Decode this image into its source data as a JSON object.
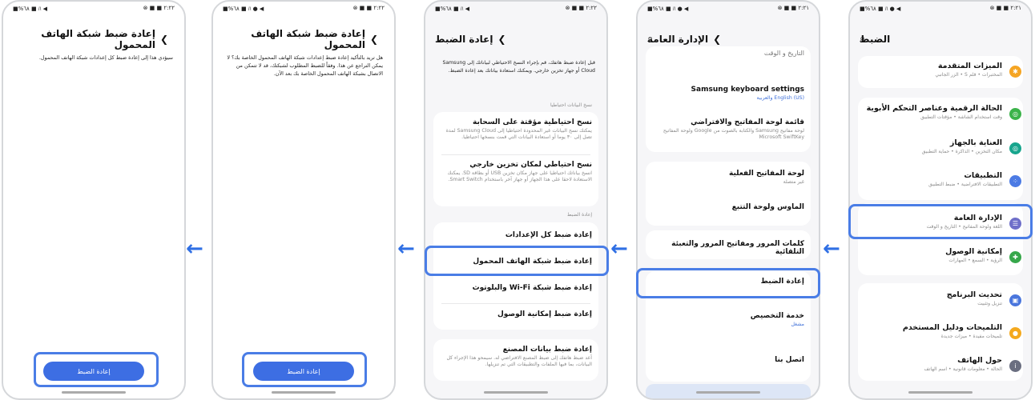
{
  "status": {
    "p1": {
      "left": "■%٦٨ ■ ﾊ ● ◀",
      "right": "⊗ ■ ■ ٢:٢١"
    },
    "p2": {
      "left": "■%٦٨ ■ ﾊ ● ◀",
      "right": "⊗ ■ ■ ٢:٢١"
    },
    "p3": {
      "left": "■%٦٨ ■ ﾊ ◀",
      "right": "⊗ ■ ■ ٢:٢٢"
    },
    "p4": {
      "left": "■%٦٨ ■ ﾊ ● ◀",
      "right": "⊗ ■ ■ ٢:٢٢"
    },
    "p5": {
      "left": "■%٦٨ ■ ﾊ ◀",
      "right": "⊗ ■ ■ ٢:٢٢"
    }
  },
  "screen1": {
    "title": "الضبط",
    "items": [
      {
        "title": "الميزات المتقدمة",
        "sub": "المختبرات • قلم S • الزر الجانبي",
        "color": "#f5a524",
        "icon": "gear-advanced-icon"
      },
      {
        "title": "الحالة الرقمية وعناصر التحكم الأبوية",
        "sub": "وقت استخدام الشاشة • مؤقتات التطبيق",
        "color": "#3bb34a",
        "icon": "digital-wellbeing-icon"
      },
      {
        "title": "العناية بالجهاز",
        "sub": "مكان التخزين • الذاكرة • حماية التطبيق",
        "color": "#17a58d",
        "icon": "device-care-icon"
      },
      {
        "title": "التطبيقات",
        "sub": "التطبيقات الافتراضية • ضبط التطبيق",
        "color": "#4c7be4",
        "icon": "apps-grid-icon"
      },
      {
        "title": "الإدارة العامة",
        "sub": "اللغة ولوحة المفاتيح • التاريخ و الوقت",
        "color": "#6f6fc9",
        "icon": "general-management-icon"
      },
      {
        "title": "إمكانية الوصول",
        "sub": "الرؤية • السمع • المهارات",
        "color": "#37a74b",
        "icon": "accessibility-icon"
      },
      {
        "title": "تحديث البرنامج",
        "sub": "تنزيل وتثبيت",
        "color": "#4a76dd",
        "icon": "software-update-icon"
      },
      {
        "title": "التلميحات ودليل المستخدم",
        "sub": "تلميحات مفيدة • ميزات جديدة",
        "color": "#f4a91e",
        "icon": "tips-bulb-icon"
      },
      {
        "title": "حول الهاتف",
        "sub": "الحالة • معلومات قانونية • اسم الهاتف",
        "color": "#6a6e80",
        "icon": "info-icon"
      }
    ]
  },
  "screen2": {
    "title": "الإدارة العامة",
    "cut_item": "التاريخ و الوقت",
    "items": [
      {
        "title": "Samsung keyboard settings",
        "sub": "English (US) والعربية",
        "blue": true
      },
      {
        "title": "قائمة لوحة المفاتيح والافتراضي",
        "sub": "لوحة مفاتيح Samsung والكتابة بالصوت من Google ولوحة المفاتيح Microsoft SwiftKey"
      },
      {
        "title": "لوحة المفاتيح الفعلية",
        "sub": "غير متصلة"
      },
      {
        "title": "الماوس ولوحة التتبع",
        "sub": ""
      },
      {
        "title": "كلمات المرور ومفاتيح المرور والتعبئة التلقائية",
        "sub": ""
      },
      {
        "title": "إعادة الضبط",
        "sub": ""
      },
      {
        "title": "خدمة التخصيص",
        "sub": "مشغل",
        "blue": true
      },
      {
        "title": "اتصل بنا",
        "sub": ""
      }
    ]
  },
  "screen3": {
    "title": "إعادة الضبط",
    "intro": "قبل إعادة ضبط هاتفك، قم بإجراء النسخ الاحتياطي لبياناتك إلى Samsung Cloud أو جهاز تخزين خارجي. ويمكنك استعادة بياناتك بعد إعادة الضبط.",
    "backup_header": "نسخ البيانات احتياطيا",
    "cloud": {
      "title": "نسخ احتياطية مؤقتة على السحابة",
      "sub": "يمكنك نسخ البيانات غير المحدودة احتياطيا إلى Samsung Cloud لمدة تصل إلى ٣٠ يوما أو استعادة البيانات التي قمت بنسخها احتياطيا."
    },
    "external": {
      "title": "نسخ احتياطي لمكان تخزين خارجي",
      "sub": "انسخ بياناتك احتياطيا على جهاز مكان تخزين USB أو بطاقة SD. يمكنك الاستعادة لاحقا على هذا الجهاز أو جهاز آخر باستخدام Smart Switch."
    },
    "reset_header": "إعادة الضبط",
    "all": "إعادة ضبط كل الإعدادات",
    "network": "إعادة ضبط شبكة الهاتف المحمول",
    "wifi": "إعادة ضبط شبكة Wi-Fi والبلوتوث",
    "access": "إعادة ضبط إمكانية الوصول",
    "factory": {
      "title": "إعادة ضبط بيانات المصنع",
      "sub": "أعد ضبط هاتفك إلى ضبط المصنع الافتراضي له. سيمحو هذا الإجراء كل البيانات، بما فيها الملفات والتطبيقات التي تم تنزيلها."
    }
  },
  "screen4": {
    "title": "إعادة ضبط شبكة الهاتف المحمول",
    "body": "هل تريد بالتأكيد إعادة ضبط إعدادات شبكة الهاتف المحمول الخاصة بك؟ لا يمكن التراجع عن هذا. وفقاً للضبط المطلوب لشبكتك، قد لا تتمكن من الاتصال بشبكة الهاتف المحمول الخاصة بك بعد الآن.",
    "button": "إعادة الضبط"
  },
  "screen5": {
    "title": "إعادة ضبط شبكة الهاتف المحمول",
    "body": "سيؤدي هذا إلى إعادة ضبط كل إعدادات شبكة الهاتف المحمول.",
    "button": "إعادة الضبط"
  },
  "arrows": {
    "a1": "←",
    "a2": "←",
    "a3": "←",
    "a4": "←"
  },
  "colors": {
    "accent": "#3d6ee3",
    "highlight": "#4a7de6"
  }
}
